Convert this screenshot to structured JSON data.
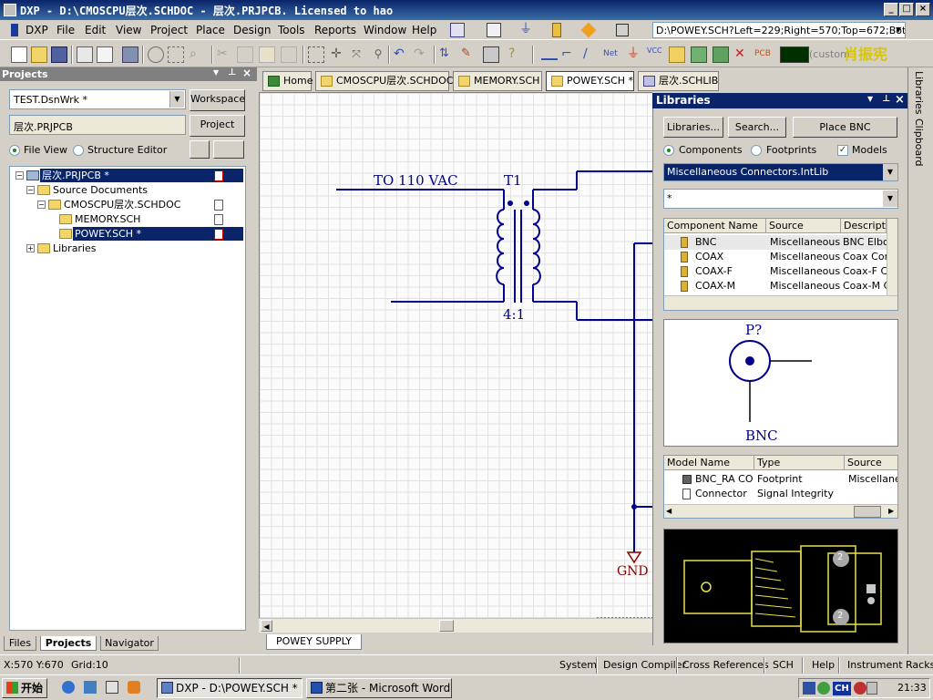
{
  "window": {
    "title": "DXP - D:\\CMOSCPU层次.SCHDOC - 层次.PRJPCB. Licensed to hao",
    "controls": [
      "minimize",
      "maximize",
      "close"
    ]
  },
  "menubar": {
    "app_label": "DXP",
    "items": [
      "File",
      "Edit",
      "View",
      "Project",
      "Place",
      "Design",
      "Tools",
      "Reports",
      "Window",
      "Help"
    ],
    "address": "D:\\POWEY.SCH?Left=229;Right=570;Top=672;Bottom",
    "custom_label": "(custom"
  },
  "watermark": "肖振宪",
  "projects_panel": {
    "title": "Projects",
    "workspace_combo": "TEST.DsnWrk *",
    "workspace_button": "Workspace",
    "project_field": "层次.PRJPCB",
    "project_button": "Project",
    "view_options": [
      {
        "label": "File View",
        "selected": true
      },
      {
        "label": "Structure Editor",
        "selected": false
      }
    ],
    "tree": [
      {
        "label": "层次.PRJPCB *",
        "level": 0,
        "selected": true
      },
      {
        "label": "Source Documents",
        "level": 1,
        "selected": false
      },
      {
        "label": "CMOSCPU层次.SCHDOC",
        "level": 2,
        "selected": false
      },
      {
        "label": "MEMORY.SCH",
        "level": 3,
        "selected": false
      },
      {
        "label": "POWEY.SCH *",
        "level": 3,
        "selected": true
      },
      {
        "label": "Libraries",
        "level": 0,
        "selected": false
      }
    ],
    "bottom_tabs": [
      "Files",
      "Projects",
      "Navigator"
    ],
    "active_bottom_tab": "Projects"
  },
  "document_tabs": [
    {
      "label": "Home",
      "active": false
    },
    {
      "label": "CMOSCPU层次.SCHDOC",
      "active": false
    },
    {
      "label": "MEMORY.SCH",
      "active": false
    },
    {
      "label": "POWEY.SCH *",
      "active": true
    },
    {
      "label": "层次.SCHLIB",
      "active": false
    }
  ],
  "schematic": {
    "input_label": "TO 110 VAC",
    "transformer_designator": "T1",
    "transformer_ratio": "4:1",
    "ground_label": "GND",
    "sheet_tab": "POWEY SUPPLY"
  },
  "libraries_panel": {
    "title": "Libraries",
    "buttons": [
      "Libraries...",
      "Search...",
      "Place BNC"
    ],
    "filters": [
      {
        "label": "Components",
        "type": "radio",
        "checked": true
      },
      {
        "label": "Footprints",
        "type": "radio",
        "checked": false
      },
      {
        "label": "Models",
        "type": "checkbox",
        "checked": true
      }
    ],
    "library_select": "Miscellaneous Connectors.IntLib",
    "filter_input": "*",
    "component_columns": [
      "Component Name",
      "Source",
      "Descriptio"
    ],
    "components": [
      {
        "name": "BNC",
        "source": "Miscellaneous C",
        "description": "BNC Elbo"
      },
      {
        "name": "COAX",
        "source": "Miscellaneous C",
        "description": "Coax Con"
      },
      {
        "name": "COAX-F",
        "source": "Miscellaneous C",
        "description": "Coax-F C"
      },
      {
        "name": "COAX-M",
        "source": "Miscellaneous C",
        "description": "Coax-M C"
      }
    ],
    "preview": {
      "designator": "P?",
      "comment": "BNC"
    },
    "model_columns": [
      "Model Name",
      "Type",
      "Source"
    ],
    "models": [
      {
        "name": "BNC_RA CON",
        "type": "Footprint",
        "source": "Miscellaneo"
      },
      {
        "name": "Connector",
        "type": "Signal Integrity",
        "source": ""
      }
    ],
    "footprint_pad_labels": [
      "2",
      "2"
    ]
  },
  "side_tabs": [
    "Libraries",
    "Clipboard"
  ],
  "statusbar": {
    "coords": "X:570 Y:670",
    "grid": "Grid:10",
    "panels": [
      "System",
      "Design Compiler",
      "Cross References",
      "SCH",
      "Help",
      "Instrument Racks"
    ]
  },
  "taskbar": {
    "start_label": "开始",
    "tasks": [
      {
        "label": "DXP - D:\\POWEY.SCH * - ...",
        "active": true
      },
      {
        "label": "第二张 - Microsoft Word",
        "active": false
      }
    ],
    "tray_ime": "CH",
    "clock": "21:33"
  },
  "colors": {
    "titlebar": "#0a246a",
    "schematic_wire": "#00008b",
    "ground_symbol": "#8b0000",
    "footprint_bg": "#000000",
    "footprint_outline": "#e8e050"
  }
}
